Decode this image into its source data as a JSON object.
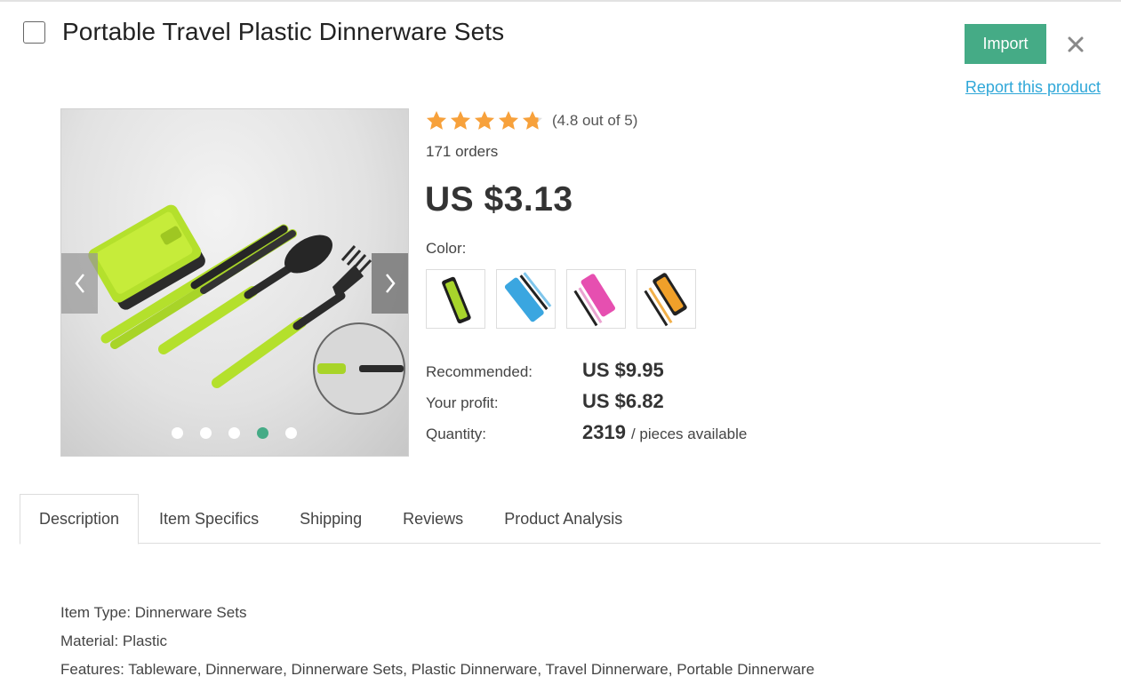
{
  "product": {
    "title": "Portable Travel Plastic Dinnerware Sets",
    "rating_text": "(4.8 out of 5)",
    "rating_value": 4.8,
    "orders": "171 orders",
    "price": "US $3.13",
    "color_label": "Color:"
  },
  "header": {
    "import_label": "Import",
    "report_label": "Report this product"
  },
  "gallery": {
    "slide_count": 5,
    "active_slide": 4
  },
  "color_options": [
    {
      "name": "green",
      "accent": "#a7d42c"
    },
    {
      "name": "blue",
      "accent": "#3aa6e0"
    },
    {
      "name": "pink",
      "accent": "#e64fb0"
    },
    {
      "name": "orange",
      "accent": "#f0a02a"
    }
  ],
  "details": {
    "recommended_label": "Recommended:",
    "recommended_value": "US $9.95",
    "profit_label": "Your profit:",
    "profit_value": "US $6.82",
    "quantity_label": "Quantity:",
    "quantity_value": "2319",
    "quantity_unit": "/ pieces available"
  },
  "tabs": [
    {
      "label": "Description",
      "active": true
    },
    {
      "label": "Item Specifics",
      "active": false
    },
    {
      "label": "Shipping",
      "active": false
    },
    {
      "label": "Reviews",
      "active": false
    },
    {
      "label": "Product Analysis",
      "active": false
    }
  ],
  "description": [
    "Item Type: Dinnerware Sets",
    "Material: Plastic",
    "Features: Tableware, Dinnerware, Dinnerware Sets, Plastic Dinnerware, Travel Dinnerware, Portable Dinnerware"
  ],
  "colors": {
    "accent": "#45ab86",
    "link": "#2fa7d8",
    "star": "#f7a13b"
  }
}
